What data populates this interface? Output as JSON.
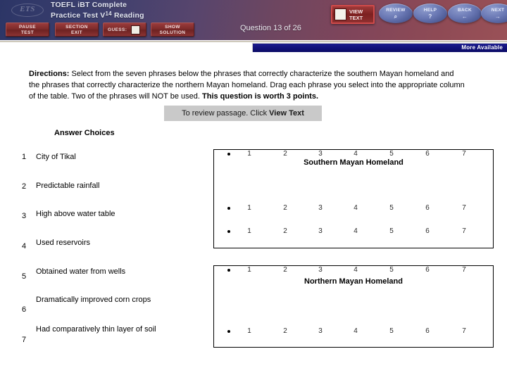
{
  "header": {
    "logo_text": "ETS",
    "logo_icon": "ets-oval-logo",
    "title_line1": "TOEFL iBT Complete",
    "title_line2_pre": "Practice Test V",
    "title_line2_sup": "14",
    "title_line2_post": " Reading",
    "question_counter": "Question 13 of 26",
    "more_available": "More Available",
    "buttons": {
      "pause_line1": "PAUSE",
      "pause_line2": "TEST",
      "exit_line1": "SECTION",
      "exit_line2": "EXIT",
      "guess_label": "GUESS:",
      "show_line1": "SHOW",
      "show_line2": "SOLUTION",
      "viewtext_line1": "VIEW",
      "viewtext_line2": "TEXT"
    },
    "nav": [
      {
        "label": "REVIEW",
        "glyph": "⌕",
        "icon": "magnifier-icon"
      },
      {
        "label": "HELP",
        "glyph": "?",
        "icon": "question-mark-icon"
      },
      {
        "label": "BACK",
        "glyph": "←",
        "icon": "left-arrow-icon"
      },
      {
        "label": "NEXT",
        "glyph": "→",
        "icon": "right-arrow-icon"
      }
    ]
  },
  "colors": {
    "header_left": "#2c3566",
    "header_right": "#9a5157",
    "button_red": "#7e2b2b",
    "nav_blue": "#6a78b4",
    "more_bar_navy": "#11117a",
    "note_gray": "#c9c9c9"
  },
  "directions": {
    "label": "Directions:",
    "body_1": " Select from the seven phrases below the phrases that correctly characterize the southern Mayan homeland and the phrases that correctly characterize the northern Mayan homeland. Drag each phrase you select into the appropriate column of the table. Two of the phrases will NOT be used. ",
    "body_bold": "This question is worth 3 points."
  },
  "review_note": {
    "text": "To review passage. Click ",
    "bold": "View Text"
  },
  "answer_choices": {
    "title": "Answer Choices",
    "items": [
      {
        "num": "1",
        "label": "City of Tikal"
      },
      {
        "num": "2",
        "label": "Predictable rainfall"
      },
      {
        "num": "3",
        "label": "High above water table"
      },
      {
        "num": "4",
        "label": "Used reservoirs"
      },
      {
        "num": "5",
        "label": "Obtained water from wells"
      },
      {
        "num": "6",
        "label": "Dramatically improved corn crops"
      },
      {
        "num": "7",
        "label": "Had comparatively thin layer of soil"
      }
    ]
  },
  "drop_tables": [
    {
      "title": "Southern Mayan Homeland",
      "rows": [
        {
          "slots": [
            "1",
            "2",
            "3",
            "4",
            "5",
            "6",
            "7"
          ]
        },
        {
          "slots": [
            "1",
            "2",
            "3",
            "4",
            "5",
            "6",
            "7"
          ]
        },
        {
          "slots": [
            "1",
            "2",
            "3",
            "4",
            "5",
            "6",
            "7"
          ]
        }
      ]
    },
    {
      "title": "Northern Mayan Homeland",
      "rows": [
        {
          "slots": [
            "1",
            "2",
            "3",
            "4",
            "5",
            "6",
            "7"
          ]
        },
        {
          "slots": [
            "1",
            "2",
            "3",
            "4",
            "5",
            "6",
            "7"
          ]
        }
      ]
    }
  ]
}
